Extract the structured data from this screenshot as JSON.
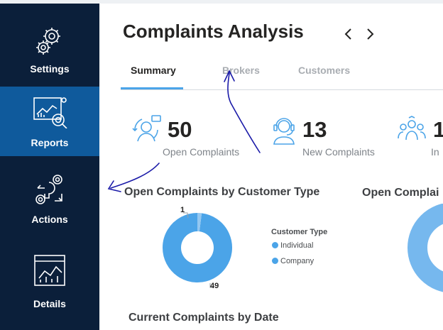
{
  "sidebar": {
    "items": [
      {
        "label": "Settings",
        "icon": "gear-cluster-icon"
      },
      {
        "label": "Reports",
        "icon": "report-chart-icon",
        "active": true
      },
      {
        "label": "Actions",
        "icon": "actions-icon"
      },
      {
        "label": "Details",
        "icon": "details-chart-icon"
      }
    ]
  },
  "header": {
    "title": "Complaints Analysis",
    "prev_icon": "chevron-left-icon",
    "next_icon": "chevron-right-icon"
  },
  "tabs": [
    {
      "label": "Summary",
      "active": true
    },
    {
      "label": "Brokers",
      "active": false
    },
    {
      "label": "Customers",
      "active": false
    }
  ],
  "kpis": [
    {
      "value": "50",
      "label": "Open Complaints",
      "icon": "support-agent-icon"
    },
    {
      "value": "13",
      "label": "New Complaints",
      "icon": "headset-agent-icon"
    },
    {
      "value": "1",
      "label": "In",
      "icon": "people-group-icon"
    }
  ],
  "sections": {
    "customer_type_title": "Open Complaints by Customer Type",
    "second_title": "Open Complai",
    "date_title": "Current Complaints by Date"
  },
  "legend": {
    "title": "Customer Type",
    "items": [
      "Individual",
      "Company"
    ]
  },
  "colors": {
    "sidebar": "#0b1f3a",
    "sidebar_active": "#0f5a9c",
    "accent": "#4ba4e8",
    "donut_second": "#76b8ee",
    "ink": "#1a1aa8"
  },
  "chart_data": [
    {
      "type": "pie",
      "title": "Open Complaints by Customer Type",
      "categories": [
        "Individual",
        "Company"
      ],
      "values": [
        49,
        1
      ],
      "data_labels": [
        "49",
        "1"
      ],
      "donut": true,
      "legend_position": "right"
    }
  ]
}
